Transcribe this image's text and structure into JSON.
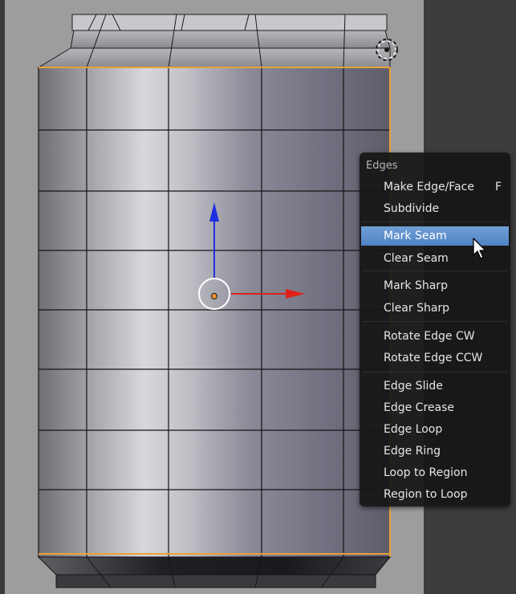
{
  "context_menu": {
    "title": "Edges",
    "groups": [
      [
        {
          "label": "Make Edge/Face",
          "shortcut": "F"
        },
        {
          "label": "Subdivide",
          "shortcut": ""
        }
      ],
      [
        {
          "label": "Mark Seam",
          "shortcut": "",
          "active": true
        },
        {
          "label": "Clear Seam",
          "shortcut": ""
        }
      ],
      [
        {
          "label": "Mark Sharp",
          "shortcut": ""
        },
        {
          "label": "Clear Sharp",
          "shortcut": ""
        }
      ],
      [
        {
          "label": "Rotate Edge CW",
          "shortcut": ""
        },
        {
          "label": "Rotate Edge CCW",
          "shortcut": ""
        }
      ],
      [
        {
          "label": "Edge Slide",
          "shortcut": ""
        },
        {
          "label": "Edge Crease",
          "shortcut": ""
        },
        {
          "label": "Edge Loop",
          "shortcut": ""
        },
        {
          "label": "Edge Ring",
          "shortcut": ""
        },
        {
          "label": "Loop to Region",
          "shortcut": ""
        },
        {
          "label": "Region to Loop",
          "shortcut": ""
        }
      ]
    ]
  },
  "colors": {
    "highlight": "#5a8ccc",
    "selected_edge": "#e6a23c",
    "gizmo_x": "#e0201a",
    "gizmo_z": "#2030e0",
    "menu_bg": "#161616",
    "dark_panel": "#3c3c3c"
  },
  "icons": [
    "3d-cursor-icon",
    "mouse-pointer-icon",
    "transform-gizmo-icon"
  ]
}
